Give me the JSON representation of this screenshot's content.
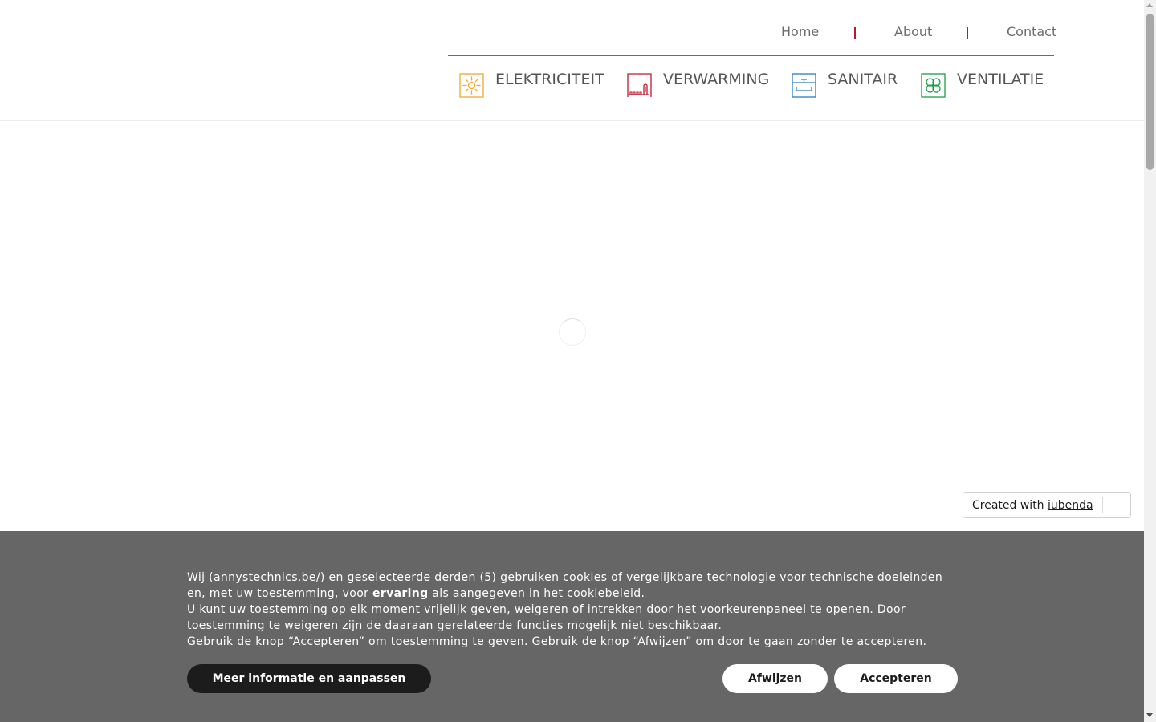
{
  "topnav": {
    "home": "Home",
    "about": "About",
    "contact": "Contact",
    "separator_color": "#c0162c"
  },
  "categories": [
    {
      "label": "ELEKTRICITEIT",
      "icon": "sun-icon",
      "color": "#f0a830"
    },
    {
      "label": "VERWARMING",
      "icon": "radiator-icon",
      "color": "#c0162c"
    },
    {
      "label": "SANITAIR",
      "icon": "faucet-icon",
      "color": "#2a7cc7"
    },
    {
      "label": "VENTILATIE",
      "icon": "fan-icon",
      "color": "#1f9a4a"
    }
  ],
  "iubenda": {
    "prefix": "Created with",
    "link": "iubenda",
    "icon": "keyhole-icon",
    "accent": "#1cc691"
  },
  "cookie_banner": {
    "line1_a": "Wij (annystechnics.be/) en geselecteerde derden (5) gebruiken cookies of vergelijkbare technologie voor technische doeleinden en, met uw toestemming, voor ",
    "line1_bold": "ervaring",
    "line1_b": " als aangegeven in het ",
    "line1_link": "cookiebeleid",
    "line1_end": ".",
    "line2": "U kunt uw toestemming op elk moment vrijelijk geven, weigeren of intrekken door het voorkeurenpaneel te openen. Door toestemming te weigeren zijn de daaraan gerelateerde functies mogelijk niet beschikbaar.",
    "line3": "Gebruik de knop “Accepteren” om toestemming te geven. Gebruik de knop “Afwijzen” om door te gaan zonder te accepteren.",
    "more_button": "Meer informatie en aanpassen",
    "reject_button": "Afwijzen",
    "accept_button": "Accepteren",
    "background": "#666666"
  }
}
